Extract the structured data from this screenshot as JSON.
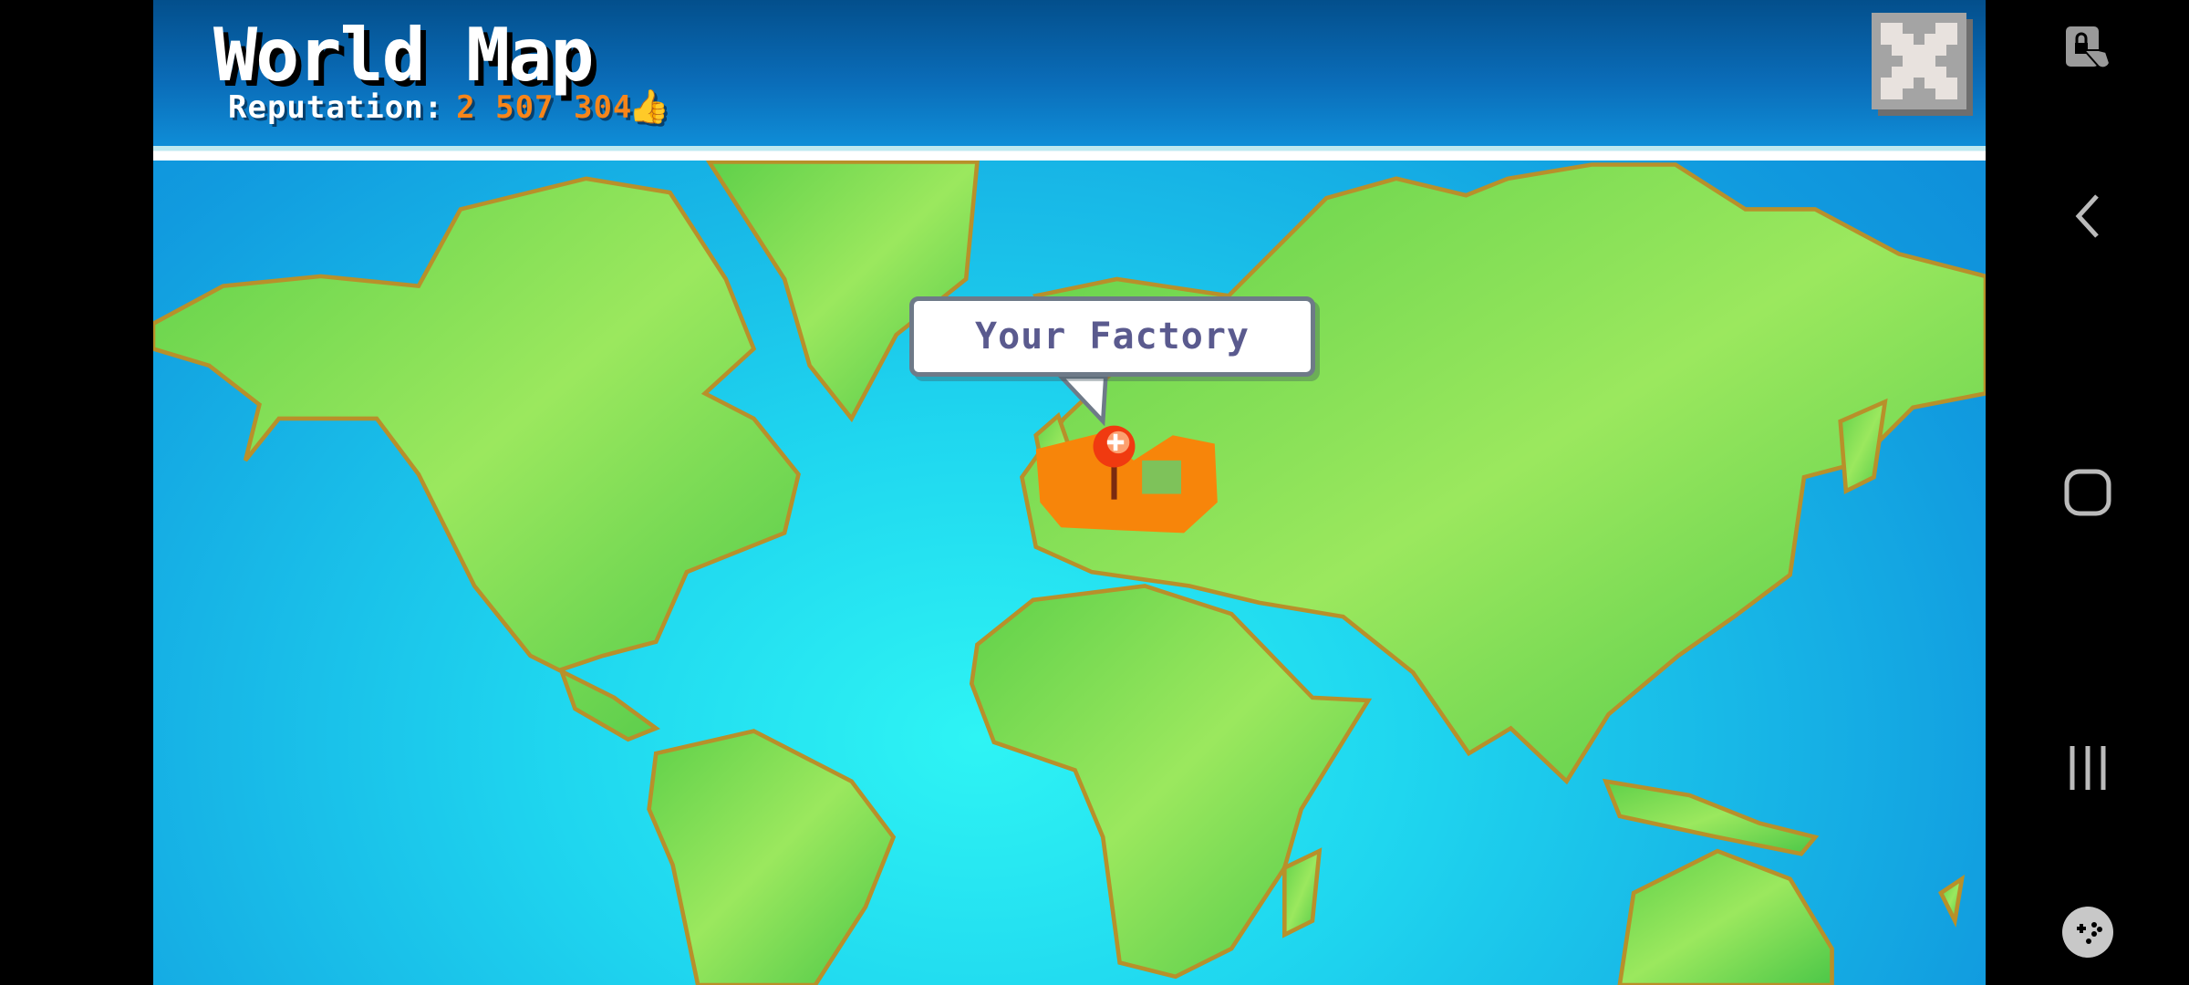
{
  "header": {
    "title": "World Map",
    "reputation_label": "Reputation:",
    "reputation_value": "2 507 304",
    "reputation_icon": "thumbs-up-icon",
    "close_icon": "close-icon"
  },
  "map": {
    "marker_label": "Your Factory",
    "marker_icon": "map-pin-icon",
    "colors": {
      "ocean": "#1fd6ef",
      "land": "#7ddd55",
      "coast": "#b8902a",
      "highlight": "#f7850a",
      "pin": "#f03a10"
    }
  },
  "system_nav": {
    "items": [
      {
        "icon": "screen-lock-touch-icon"
      },
      {
        "icon": "back-icon"
      },
      {
        "icon": "home-icon"
      },
      {
        "icon": "recent-apps-icon"
      },
      {
        "icon": "game-controller-icon"
      }
    ]
  }
}
